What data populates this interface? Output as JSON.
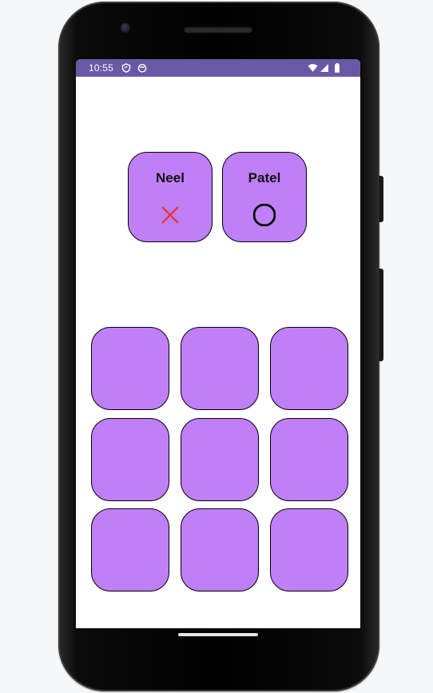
{
  "status_bar": {
    "time": "10:55",
    "left_icons": [
      "shield-icon",
      "face-icon"
    ],
    "right_icons": [
      "wifi-icon",
      "signal-icon",
      "battery-icon"
    ],
    "background": "#6a58a6"
  },
  "players": [
    {
      "name": "Neel",
      "symbol": "X",
      "symbol_icon": "x-mark-icon",
      "symbol_color": "#e53935"
    },
    {
      "name": "Patel",
      "symbol": "O",
      "symbol_icon": "circle-o-icon",
      "symbol_color": "#000000"
    }
  ],
  "board": {
    "cells": [
      "",
      "",
      "",
      "",
      "",
      "",
      "",
      "",
      ""
    ],
    "cell_color": "#bf7ff7"
  },
  "accent_color": "#bf7ff7"
}
